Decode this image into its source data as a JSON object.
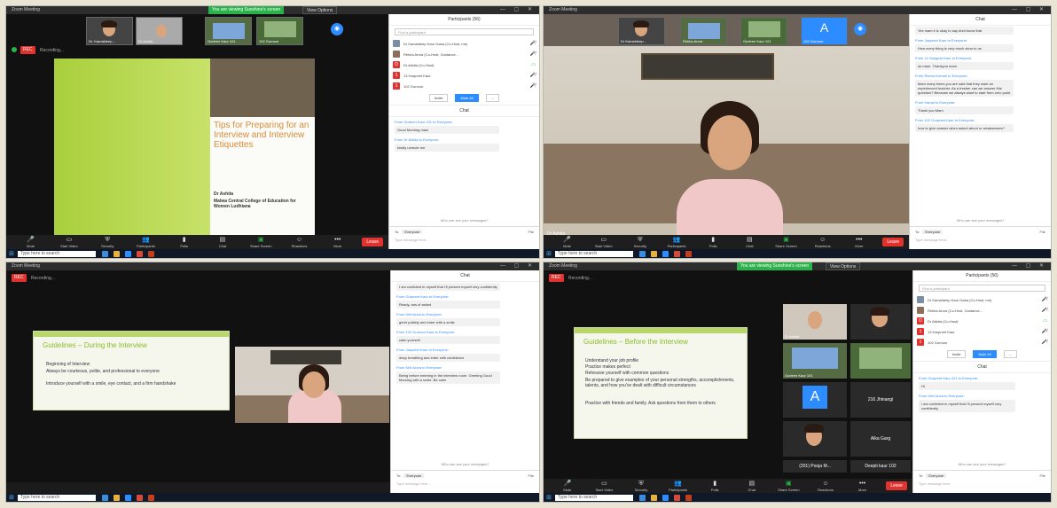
{
  "common": {
    "app_title": "Zoom Meeting",
    "share_bar": "You are viewing Sunshine's screen",
    "stop_share": "View Options",
    "rec": "REC",
    "recording": "Recording...",
    "taskbar_search": "Type here to search",
    "toolbar": [
      "Mute",
      "Start Video",
      "Security",
      "Participants",
      "Polls",
      "Chat",
      "Share Screen",
      "Reactions",
      "More"
    ],
    "end_label": "Leave",
    "chat_title": "Chat",
    "chat_to_label": "To:",
    "chat_to_value": "Everyone",
    "chat_placeholder": "Type message here...",
    "chat_file": "File",
    "who_see": "Who can see your messages?"
  },
  "q1": {
    "participants_title": "Participants (56)",
    "find_placeholder": "Find a participant",
    "participants": [
      {
        "name": "Dr Kamaldeep Kaur Gaba (Co-Host, me)",
        "color": "#7a8fa6"
      },
      {
        "name": "Rekha Arora (Co-Host, Guidance...",
        "color": "#8a6f5b"
      },
      {
        "name": "Dr Akkita (Co-Host)",
        "color": "#e0332f"
      },
      {
        "name": "13 Harpreet Kaur",
        "color": "#e0332f"
      },
      {
        "name": "102 Gurnoor",
        "color": "#e0332f"
      }
    ],
    "invite": "Invite",
    "mute_all": "Mute All",
    "more": "...",
    "chat": [
      {
        "from": "From Gurleen Kaur 101 to Everyone:",
        "msg": "Good Morning mam"
      },
      {
        "from": "From Dr Akkita to Everyone:",
        "msg": "kindly unmute me"
      }
    ],
    "slide_title": "Tips for Preparing for an Interview and Interview Etiquettes",
    "slide_author": "Dr Ashita",
    "slide_college": "Malwa Central College of Education for Women Ludhiana",
    "thumbs": [
      "Dr. Kamaldeep...",
      "Dr Ashita",
      "Gurleen Kaur 101",
      "102 Gurnoor"
    ]
  },
  "q2": {
    "chat": [
      {
        "from": "From Mohit to Everyone:",
        "msg": "Yes mam it is okay to say dont know that"
      },
      {
        "from": "From Jaspreet Kaur to Everyone:",
        "msg": "How every thing is very much clear to us"
      },
      {
        "from": "From 10 Sangeet Kaur to Everyone:",
        "msg": "ok mam. Thankyou mam"
      },
      {
        "from": "From Reena Kumari to Everyone:",
        "msg": "Mam many times you are said that they want an experienced teacher. As a fresher can we answer this question? Because we always want to start from zero point"
      },
      {
        "from": "From Kamal to Everyone:",
        "msg": "Thank you Mam"
      },
      {
        "from": "From 102 Gurpreet Kaur to Everyone:",
        "msg": "how to give answer when asked about ur weaknesses?"
      }
    ],
    "thumbs": [
      "Dr Kamaldeep...",
      "Rekha Arora",
      "Gurleen Kaur 101",
      "102 Gurnoor"
    ],
    "avatar_letter": "A",
    "speaker_name": "Dr Ashita"
  },
  "q3": {
    "chat": [
      {
        "from": "",
        "msg": "I am confident in myself that I'll present myself very confidently"
      },
      {
        "from": "From Gurpreet Kaur to Everyone:",
        "msg": "Ready, ans of asked"
      },
      {
        "from": "From Kirti Arora to Everyone:",
        "msg": "greet politely and enter with a smile"
      },
      {
        "from": "From 102 Gurnoor Kaur to Everyone:",
        "msg": "calm yourself"
      },
      {
        "from": "From Jaspreet Kaur to Everyone:",
        "msg": "deep breathing and enter with confidence"
      },
      {
        "from": "From Kirti Arora to Everyone:",
        "msg": "Being before entering in the interview room. Greeting Good Morning with a smile. Be calm"
      }
    ],
    "slide_title": "Guidelines – During the Interview",
    "slide_points": [
      "Beginning of Interview",
      "Always be courteous, polite, and professional to everyone",
      "Introduce yourself with a smile, eye contact, and a firm handshake"
    ]
  },
  "q4": {
    "participants_title": "Participants (56)",
    "find_placeholder": "Find a participant",
    "participants": [
      {
        "name": "Dr Kamaldeep Kaur Gaba (Co-Host, me)",
        "color": "#7a8fa6"
      },
      {
        "name": "Rekha Arora (Co-Host, Guidance...",
        "color": "#8a6f5b"
      },
      {
        "name": "Dr Akkita (Co-Host)",
        "color": "#e0332f"
      },
      {
        "name": "13 Harpreet Kaur",
        "color": "#e0332f"
      },
      {
        "name": "102 Gurnoor",
        "color": "#e0332f"
      }
    ],
    "chat": [
      {
        "from": "From Gurpreet Kaur 101 to Everyone:",
        "msg": "Hi"
      },
      {
        "from": "From Kirti Arora to Everyone:",
        "msg": "I am confident in myself that I'll present myself very confidently"
      }
    ],
    "slide_title": "Guidelines – Before the Interview",
    "slide_points": [
      "Understand your job profile",
      "Practice makes perfect",
      "Rehearse yourself with common questions",
      "Be prepared to give examples of your personal strengths, accomplishments, talents, and how you've dealt with difficult circumstances",
      "Practice with friends and family. Ask questions from them to others"
    ],
    "tiles": [
      "Dr Ashita",
      "Gurleen Kaur 101",
      "A",
      "216 Jhinangi",
      "",
      "Alka Garg",
      "(201) Pooja M...",
      "Deepti kaur 102"
    ]
  }
}
